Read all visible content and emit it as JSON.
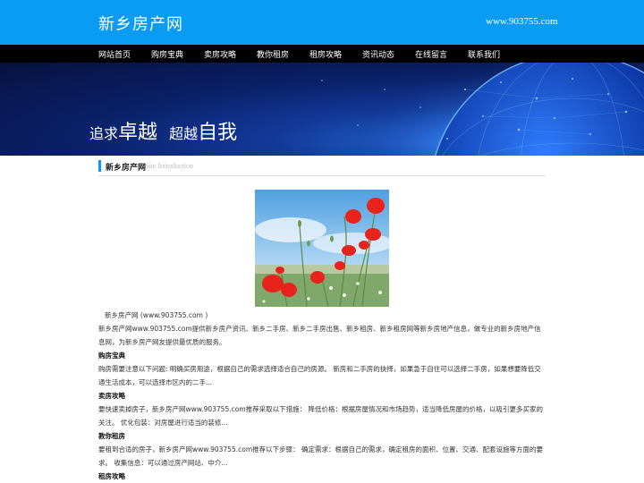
{
  "header": {
    "site_title": "新乡房产网",
    "site_url": "www.903755.com"
  },
  "nav": {
    "items": [
      "网站首页",
      "购房宝典",
      "卖房攻略",
      "教你租房",
      "租房攻略",
      "资讯动态",
      "在线留言",
      "联系我们"
    ]
  },
  "banner": {
    "slogan_1_small": "追求",
    "slogan_1_big": "卓越",
    "slogan_2_small": "超越",
    "slogan_2_big": "自我"
  },
  "section": {
    "title": "新乡房产网",
    "subtitle": "Site Introduction"
  },
  "content": {
    "intro_name": "新乡房产网 (www.903755.com )",
    "intro_text": "新乡房产网www.903755.com提供新乡房产资讯、新乡二手房、新乡二手房出售、新乡租房、新乡租房网等新乡房地产信息，做专业的新乡房地产信息网，为新乡房产网友提供最优质的服务。",
    "h1": "购房宝典",
    "p1": "购房需要注意以下问题: 明确买房用途，根据自己的需求选择适合自己的房源。 新房和二手房的抉择，如果急于自住可以选择二手房，如果想要降低交通生活成本，可以选择市区内的二手...",
    "h2": "卖房攻略",
    "p2": "要快速卖掉房子，新乡房产网www.903755.com推荐采取以下措施： 降低价格：根据房屋情况和市场趋势，适当降低房屋的价格，以吸引更多买家的关注。 优化包装：对房屋进行适当的装修...",
    "h3": "教你租房",
    "p3": "要租到合适的房子，新乡房产网www.903755.com推荐以下步骤： 确定需求：根据自己的需求，确定租房的面积、位置、交通、配套设施等方面的要求。 收集信息：可以通过房产网站、中介...",
    "h4": "租房攻略"
  },
  "colors": {
    "topbar": "#0a9bf5",
    "navbar": "#000000",
    "accent": "#0a9bf5"
  }
}
